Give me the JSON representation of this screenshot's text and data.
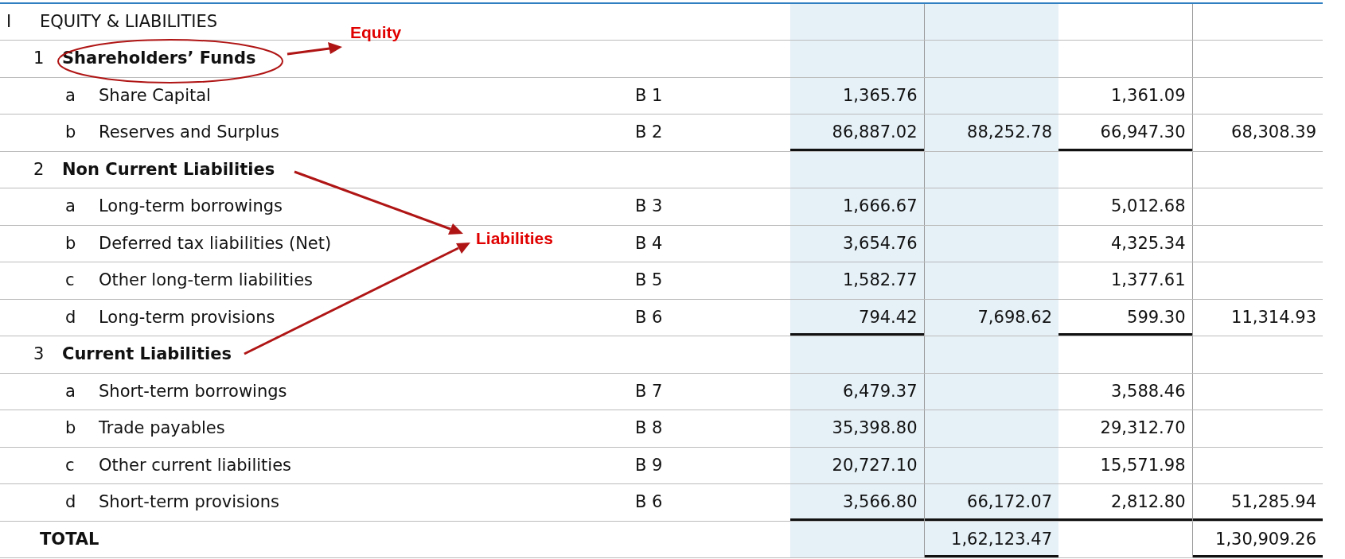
{
  "rows": [
    {
      "kind": "heading",
      "marker": "I",
      "label": "EQUITY & LIABILITIES",
      "cells": [
        {},
        {},
        {},
        {}
      ]
    },
    {
      "kind": "section",
      "marker": "1",
      "label": "Shareholders’ Funds",
      "cells": [
        {},
        {},
        {},
        {}
      ]
    },
    {
      "kind": "item",
      "marker": "a",
      "label": "Share Capital",
      "ref": "B 1",
      "cells": [
        {
          "text": "1,365.76"
        },
        {},
        {
          "text": "1,361.09"
        },
        {}
      ]
    },
    {
      "kind": "item",
      "marker": "b",
      "label": "Reserves and Surplus",
      "ref": "B 2",
      "cells": [
        {
          "text": "86,887.02",
          "rule_below": true
        },
        {
          "text": "88,252.78"
        },
        {
          "text": "66,947.30",
          "rule_below": true
        },
        {
          "text": "68,308.39"
        }
      ]
    },
    {
      "kind": "section",
      "marker": "2",
      "label": "Non Current Liabilities",
      "cells": [
        {},
        {},
        {},
        {}
      ]
    },
    {
      "kind": "item",
      "marker": "a",
      "label": "Long-term borrowings",
      "ref": "B 3",
      "cells": [
        {
          "text": "1,666.67"
        },
        {},
        {
          "text": "5,012.68"
        },
        {}
      ]
    },
    {
      "kind": "item",
      "marker": "b",
      "label": "Deferred tax liabilities (Net)",
      "ref": "B 4",
      "cells": [
        {
          "text": "3,654.76"
        },
        {},
        {
          "text": "4,325.34"
        },
        {}
      ]
    },
    {
      "kind": "item",
      "marker": "c",
      "label": "Other long-term liabilities",
      "ref": "B 5",
      "cells": [
        {
          "text": "1,582.77"
        },
        {},
        {
          "text": "1,377.61"
        },
        {}
      ]
    },
    {
      "kind": "item",
      "marker": "d",
      "label": "Long-term provisions",
      "ref": "B 6",
      "cells": [
        {
          "text": "794.42",
          "rule_below": true
        },
        {
          "text": "7,698.62"
        },
        {
          "text": "599.30",
          "rule_below": true
        },
        {
          "text": "11,314.93"
        }
      ]
    },
    {
      "kind": "section",
      "marker": "3",
      "label": "Current Liabilities",
      "cells": [
        {},
        {},
        {},
        {}
      ]
    },
    {
      "kind": "item",
      "marker": "a",
      "label": "Short-term borrowings",
      "ref": "B 7",
      "cells": [
        {
          "text": "6,479.37"
        },
        {},
        {
          "text": "3,588.46"
        },
        {}
      ]
    },
    {
      "kind": "item",
      "marker": "b",
      "label": "Trade payables",
      "ref": "B 8",
      "cells": [
        {
          "text": "35,398.80"
        },
        {},
        {
          "text": "29,312.70"
        },
        {}
      ]
    },
    {
      "kind": "item",
      "marker": "c",
      "label": "Other current liabilities",
      "ref": "B 9",
      "cells": [
        {
          "text": "20,727.10"
        },
        {},
        {
          "text": "15,571.98"
        },
        {}
      ]
    },
    {
      "kind": "item",
      "marker": "d",
      "label": "Short-term provisions",
      "ref": "B 6",
      "cells": [
        {
          "text": "3,566.80",
          "rule_below": true
        },
        {
          "text": "66,172.07",
          "rule_below": true
        },
        {
          "text": "2,812.80",
          "rule_below": true
        },
        {
          "text": "51,285.94",
          "rule_below": true
        }
      ]
    },
    {
      "kind": "total",
      "label": "TOTAL",
      "cells": [
        {},
        {
          "text": "1,62,123.47",
          "rule_below": true
        },
        {},
        {
          "text": "1,30,909.26",
          "rule_below": true
        }
      ]
    }
  ],
  "annotations": [
    {
      "text": "Equity"
    },
    {
      "text": "Liabilities"
    }
  ]
}
